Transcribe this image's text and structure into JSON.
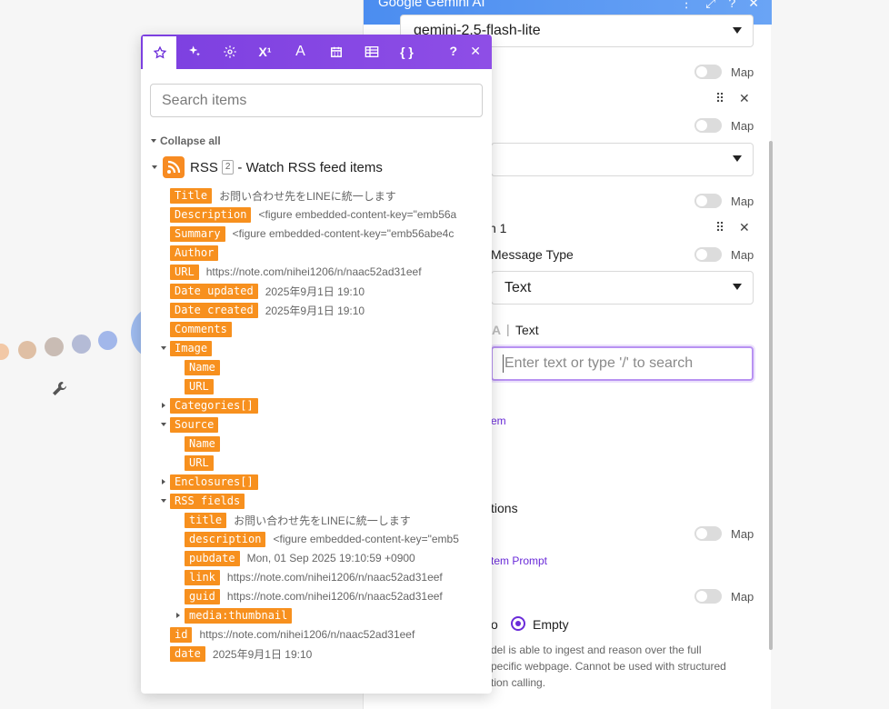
{
  "colors": {
    "accent_purple": "#7c3fe0",
    "pill_orange": "#f7901e",
    "header_blue": "#4b8df0"
  },
  "right_panel": {
    "header_title": "Google Gemini AI",
    "header_icons": [
      "more-icon",
      "expand-icon",
      "help-icon",
      "close-icon"
    ],
    "model_value": "gemini-2.5-flash-lite",
    "map_label": "Map",
    "item_partial": "n 1",
    "message_type_label": "Message Type",
    "message_type_value": "Text",
    "text_label": "Text",
    "text_input_placeholder": "Enter text or type '/' to search",
    "add_item_link": "em",
    "instructions_partial": "tions",
    "add_prompt_link": "tem Prompt",
    "radio_left_partial": "o",
    "radio_empty_label": "Empty",
    "help_lines": [
      "del is able to ingest and reason over the full",
      "pecific webpage. Cannot be used with structured",
      "tion calling."
    ]
  },
  "popup": {
    "tabs": [
      "star-icon",
      "sparkle-icon",
      "gear-icon",
      "superscript-icon",
      "text-icon",
      "calendar-icon",
      "table-icon",
      "braces-icon"
    ],
    "help_label": "?",
    "close_label": "✕",
    "search_placeholder": "Search items",
    "collapse_all_label": "Collapse all",
    "module": {
      "name": "RSS",
      "count": "2",
      "title": "- Watch RSS feed items"
    },
    "items": [
      {
        "label": "Title",
        "value": "お問い合わせ先をLINEに統一します"
      },
      {
        "label": "Description",
        "value": "<figure embedded-content-key=\"emb56a"
      },
      {
        "label": "Summary",
        "value": "<figure embedded-content-key=\"emb56abe4c"
      },
      {
        "label": "Author",
        "value": ""
      },
      {
        "label": "URL",
        "value": "https://note.com/nihei1206/n/naac52ad31eef"
      },
      {
        "label": "Date updated",
        "value": "2025年9月1日 19:10"
      },
      {
        "label": "Date created",
        "value": "2025年9月1日 19:10"
      },
      {
        "label": "Comments",
        "value": ""
      },
      {
        "label": "Image",
        "value": ""
      },
      {
        "label": "Name",
        "value": ""
      },
      {
        "label": "URL",
        "value": ""
      },
      {
        "label": "Categories[]",
        "value": ""
      },
      {
        "label": "Source",
        "value": ""
      },
      {
        "label": "Name",
        "value": ""
      },
      {
        "label": "URL",
        "value": ""
      },
      {
        "label": "Enclosures[]",
        "value": ""
      },
      {
        "label": "RSS fields",
        "value": ""
      },
      {
        "label": "title",
        "value": "お問い合わせ先をLINEに統一します"
      },
      {
        "label": "description",
        "value": "<figure embedded-content-key=\"emb5"
      },
      {
        "label": "pubdate",
        "value": "Mon, 01 Sep 2025 19:10:59 +0900"
      },
      {
        "label": "link",
        "value": "https://note.com/nihei1206/n/naac52ad31eef"
      },
      {
        "label": "guid",
        "value": "https://note.com/nihei1206/n/naac52ad31eef"
      },
      {
        "label": "media:thumbnail",
        "value": ""
      },
      {
        "label": "id",
        "value": "https://note.com/nihei1206/n/naac52ad31eef"
      },
      {
        "label": "date",
        "value": "2025年9月1日 19:10"
      }
    ]
  }
}
